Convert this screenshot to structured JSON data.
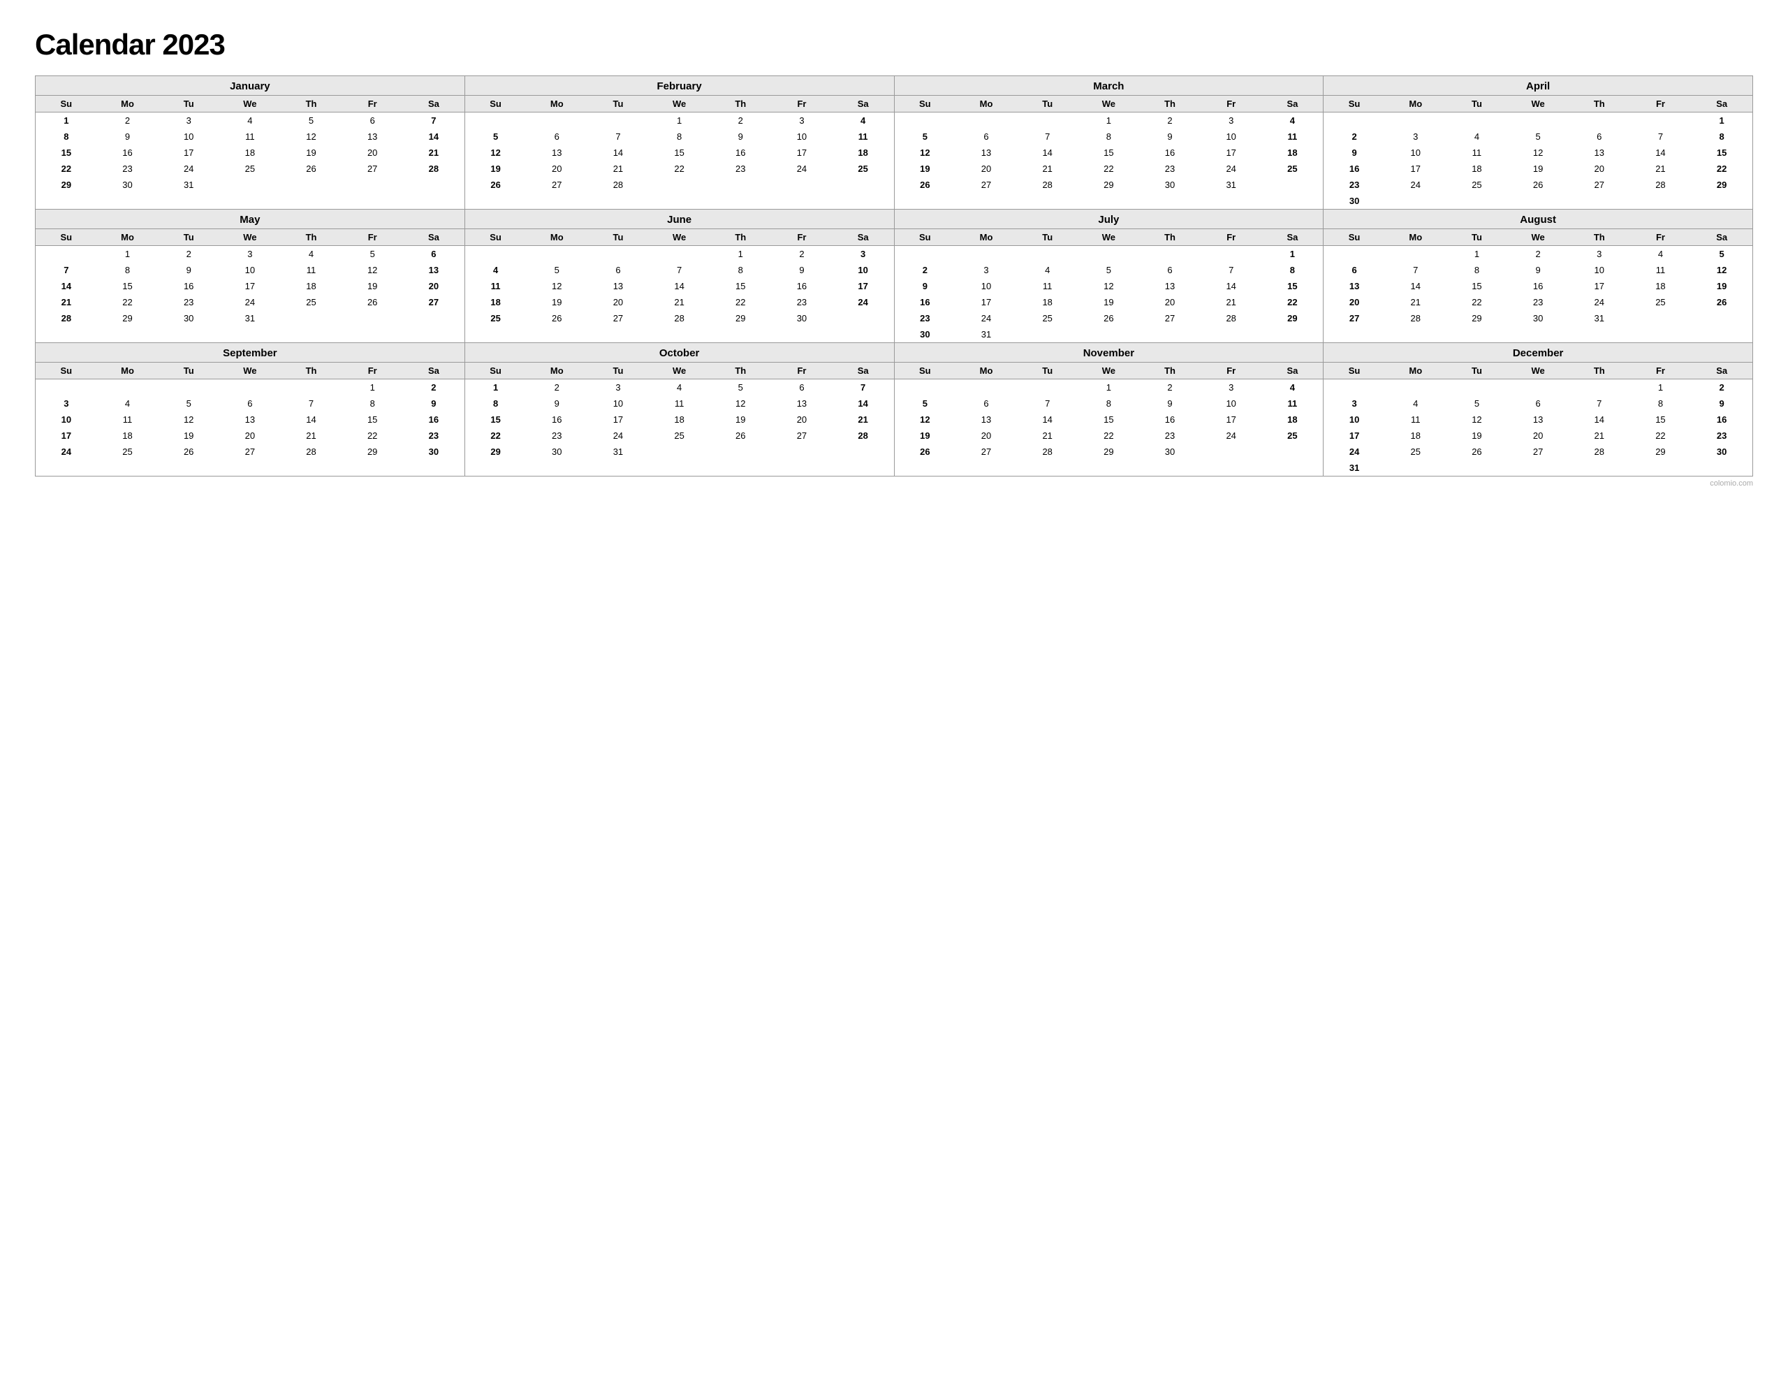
{
  "title": "Calendar 2023",
  "watermark": "colomio.com",
  "months": [
    {
      "name": "January",
      "weeks": [
        [
          "1",
          "2",
          "3",
          "4",
          "5",
          "6",
          "7"
        ],
        [
          "8",
          "9",
          "10",
          "11",
          "12",
          "13",
          "14"
        ],
        [
          "15",
          "16",
          "17",
          "18",
          "19",
          "20",
          "21"
        ],
        [
          "22",
          "23",
          "24",
          "25",
          "26",
          "27",
          "28"
        ],
        [
          "29",
          "30",
          "31",
          "",
          "",
          "",
          ""
        ]
      ]
    },
    {
      "name": "February",
      "weeks": [
        [
          "",
          "",
          "",
          "1",
          "2",
          "3",
          "4"
        ],
        [
          "5",
          "6",
          "7",
          "8",
          "9",
          "10",
          "11"
        ],
        [
          "12",
          "13",
          "14",
          "15",
          "16",
          "17",
          "18"
        ],
        [
          "19",
          "20",
          "21",
          "22",
          "23",
          "24",
          "25"
        ],
        [
          "26",
          "27",
          "28",
          "",
          "",
          "",
          ""
        ]
      ]
    },
    {
      "name": "March",
      "weeks": [
        [
          "",
          "",
          "",
          "1",
          "2",
          "3",
          "4"
        ],
        [
          "5",
          "6",
          "7",
          "8",
          "9",
          "10",
          "11"
        ],
        [
          "12",
          "13",
          "14",
          "15",
          "16",
          "17",
          "18"
        ],
        [
          "19",
          "20",
          "21",
          "22",
          "23",
          "24",
          "25"
        ],
        [
          "26",
          "27",
          "28",
          "29",
          "30",
          "31",
          ""
        ]
      ]
    },
    {
      "name": "April",
      "weeks": [
        [
          "",
          "",
          "",
          "",
          "",
          "",
          "1"
        ],
        [
          "2",
          "3",
          "4",
          "5",
          "6",
          "7",
          "8"
        ],
        [
          "9",
          "10",
          "11",
          "12",
          "13",
          "14",
          "15"
        ],
        [
          "16",
          "17",
          "18",
          "19",
          "20",
          "21",
          "22"
        ],
        [
          "23",
          "24",
          "25",
          "26",
          "27",
          "28",
          "29"
        ],
        [
          "30",
          "",
          "",
          "",
          "",
          "",
          ""
        ]
      ]
    },
    {
      "name": "May",
      "weeks": [
        [
          "",
          "1",
          "2",
          "3",
          "4",
          "5",
          "6"
        ],
        [
          "7",
          "8",
          "9",
          "10",
          "11",
          "12",
          "13"
        ],
        [
          "14",
          "15",
          "16",
          "17",
          "18",
          "19",
          "20"
        ],
        [
          "21",
          "22",
          "23",
          "24",
          "25",
          "26",
          "27"
        ],
        [
          "28",
          "29",
          "30",
          "31",
          "",
          "",
          ""
        ]
      ]
    },
    {
      "name": "June",
      "weeks": [
        [
          "",
          "",
          "",
          "",
          "1",
          "2",
          "3"
        ],
        [
          "4",
          "5",
          "6",
          "7",
          "8",
          "9",
          "10"
        ],
        [
          "11",
          "12",
          "13",
          "14",
          "15",
          "16",
          "17"
        ],
        [
          "18",
          "19",
          "20",
          "21",
          "22",
          "23",
          "24"
        ],
        [
          "25",
          "26",
          "27",
          "28",
          "29",
          "30",
          ""
        ]
      ]
    },
    {
      "name": "July",
      "weeks": [
        [
          "",
          "",
          "",
          "",
          "",
          "",
          "1"
        ],
        [
          "2",
          "3",
          "4",
          "5",
          "6",
          "7",
          "8"
        ],
        [
          "9",
          "10",
          "11",
          "12",
          "13",
          "14",
          "15"
        ],
        [
          "16",
          "17",
          "18",
          "19",
          "20",
          "21",
          "22"
        ],
        [
          "23",
          "24",
          "25",
          "26",
          "27",
          "28",
          "29"
        ],
        [
          "30",
          "31",
          "",
          "",
          "",
          "",
          ""
        ]
      ]
    },
    {
      "name": "August",
      "weeks": [
        [
          "",
          "",
          "1",
          "2",
          "3",
          "4",
          "5"
        ],
        [
          "6",
          "7",
          "8",
          "9",
          "10",
          "11",
          "12"
        ],
        [
          "13",
          "14",
          "15",
          "16",
          "17",
          "18",
          "19"
        ],
        [
          "20",
          "21",
          "22",
          "23",
          "24",
          "25",
          "26"
        ],
        [
          "27",
          "28",
          "29",
          "30",
          "31",
          "",
          ""
        ]
      ]
    },
    {
      "name": "September",
      "weeks": [
        [
          "",
          "",
          "",
          "",
          "",
          "1",
          "2"
        ],
        [
          "3",
          "4",
          "5",
          "6",
          "7",
          "8",
          "9"
        ],
        [
          "10",
          "11",
          "12",
          "13",
          "14",
          "15",
          "16"
        ],
        [
          "17",
          "18",
          "19",
          "20",
          "21",
          "22",
          "23"
        ],
        [
          "24",
          "25",
          "26",
          "27",
          "28",
          "29",
          "30"
        ]
      ]
    },
    {
      "name": "October",
      "weeks": [
        [
          "1",
          "2",
          "3",
          "4",
          "5",
          "6",
          "7"
        ],
        [
          "8",
          "9",
          "10",
          "11",
          "12",
          "13",
          "14"
        ],
        [
          "15",
          "16",
          "17",
          "18",
          "19",
          "20",
          "21"
        ],
        [
          "22",
          "23",
          "24",
          "25",
          "26",
          "27",
          "28"
        ],
        [
          "29",
          "30",
          "31",
          "",
          "",
          "",
          ""
        ]
      ]
    },
    {
      "name": "November",
      "weeks": [
        [
          "",
          "",
          "",
          "1",
          "2",
          "3",
          "4"
        ],
        [
          "5",
          "6",
          "7",
          "8",
          "9",
          "10",
          "11"
        ],
        [
          "12",
          "13",
          "14",
          "15",
          "16",
          "17",
          "18"
        ],
        [
          "19",
          "20",
          "21",
          "22",
          "23",
          "24",
          "25"
        ],
        [
          "26",
          "27",
          "28",
          "29",
          "30",
          "",
          ""
        ]
      ]
    },
    {
      "name": "December",
      "weeks": [
        [
          "",
          "",
          "",
          "",
          "",
          "1",
          "2"
        ],
        [
          "3",
          "4",
          "5",
          "6",
          "7",
          "8",
          "9"
        ],
        [
          "10",
          "11",
          "12",
          "13",
          "14",
          "15",
          "16"
        ],
        [
          "17",
          "18",
          "19",
          "20",
          "21",
          "22",
          "23"
        ],
        [
          "24",
          "25",
          "26",
          "27",
          "28",
          "29",
          "30"
        ],
        [
          "31",
          "",
          "",
          "",
          "",
          "",
          ""
        ]
      ]
    }
  ],
  "dayHeaders": [
    "Su",
    "Mo",
    "Tu",
    "We",
    "Th",
    "Fr",
    "Sa"
  ]
}
